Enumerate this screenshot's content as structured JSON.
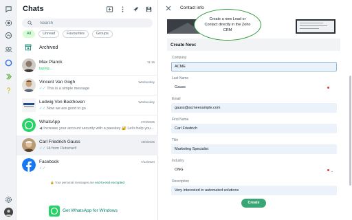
{
  "rail": {
    "icons": [
      "chats-icon",
      "status-icon",
      "channels-icon",
      "communities-icon",
      "meta-ai-icon",
      "crm-icon",
      "help-icon",
      "settings-icon",
      "profile-avatar"
    ]
  },
  "chats": {
    "title": "Chats",
    "search_placeholder": "Search",
    "filters": [
      "All",
      "Unread",
      "Favourites",
      "Groups"
    ],
    "archived_label": "Archived",
    "list": [
      {
        "name": "Max Planck",
        "preview": "typing...",
        "time": "11:16",
        "tick": "",
        "green": true
      },
      {
        "name": "Vincent Van Gogh",
        "preview": "This is a simple message",
        "time": "Wednesday",
        "tick": "✓✓",
        "green": false
      },
      {
        "name": "Ludwig Von Beethoven",
        "preview": "Now we are good to go",
        "time": "Wednesday",
        "tick": "✓✓",
        "green": false
      },
      {
        "name": "WhatsApp",
        "preview": "Increase your account security with a passkey 🔐 Let's help you...",
        "time": "27/3/2025",
        "tick": "",
        "green": false
      },
      {
        "name": "Carl Friedrich Gauss",
        "preview": "Hi from Outsmart!",
        "time": "19/3/2025",
        "tick": "✓✓",
        "green": false
      },
      {
        "name": "Facebook",
        "preview": "",
        "time": "7/12/2024",
        "tick": "✓✓",
        "green": false
      }
    ],
    "encryption_note_prefix": "🔒 Your personal messages are ",
    "encryption_note_link": "end-to-end encrypted",
    "get_whatsapp": "Get WhatsApp for Windows"
  },
  "contact_info": {
    "title": "Contact info",
    "tooltip": "Create a new Lead or Contact directly in the Zoho CRM",
    "form_title": "Create New:",
    "fields": [
      {
        "label": "Company",
        "value": "ACME"
      },
      {
        "label": "Last Name",
        "value": "Gauss"
      },
      {
        "label": "Email",
        "value": "gauss@acmeexample.com"
      },
      {
        "label": "First Name",
        "value": "Carl Friedrich"
      },
      {
        "label": "Title",
        "value": "Marketing Specialist"
      },
      {
        "label": "Industry",
        "value": "ONG"
      },
      {
        "label": "Description",
        "value": "Very interested in automated solutions"
      }
    ],
    "create_button": "Create"
  },
  "colors": {
    "accent": "#008069",
    "create_button": "#3aa675",
    "tooltip_border": "#2e9a3a",
    "field_bg": "#ebf2fa"
  }
}
